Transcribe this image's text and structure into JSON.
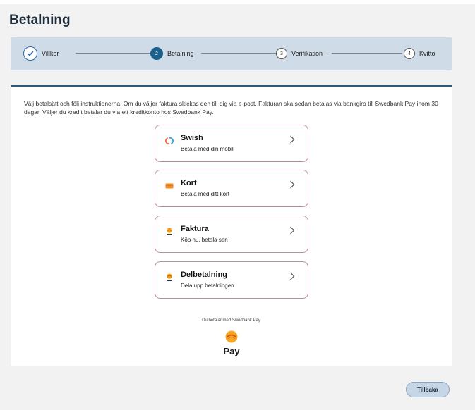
{
  "page": {
    "title": "Betalning"
  },
  "stepper": {
    "steps": [
      {
        "label": "Villkor",
        "number": "",
        "state": "done"
      },
      {
        "label": "Betalning",
        "number": "2",
        "state": "active"
      },
      {
        "label": "Verifikation",
        "number": "3",
        "state": "pending"
      },
      {
        "label": "Kvitto",
        "number": "4",
        "state": "pending"
      }
    ]
  },
  "intro": "Välj betalsätt och följ instruktionerna. Om du väljer faktura skickas den till dig via e-post. Fakturan ska sedan betalas via bankgiro till Swedbank Pay inom 30 dagar. Väljer du kredit betalar du via ett kreditkonto hos Swedbank Pay.",
  "options": [
    {
      "title": "Swish",
      "subtitle": "Betala med din mobil",
      "icon": "swish-icon"
    },
    {
      "title": "Kort",
      "subtitle": "Betala med ditt kort",
      "icon": "card-icon"
    },
    {
      "title": "Faktura",
      "subtitle": "Köp nu, betala sen",
      "icon": "swedbank-pay-icon"
    },
    {
      "title": "Delbetalning",
      "subtitle": "Dela upp betalningen",
      "icon": "swedbank-pay-icon"
    }
  ],
  "footer": {
    "note": "Du betalar med Swedbank Pay",
    "logo_word": "Pay"
  },
  "actions": {
    "back_label": "Tillbaka"
  },
  "colors": {
    "accent": "#1c5e8c",
    "stepper_bg": "#cfdbe6",
    "option_border": "#b98f97",
    "back_button": "#c6d6e6"
  }
}
